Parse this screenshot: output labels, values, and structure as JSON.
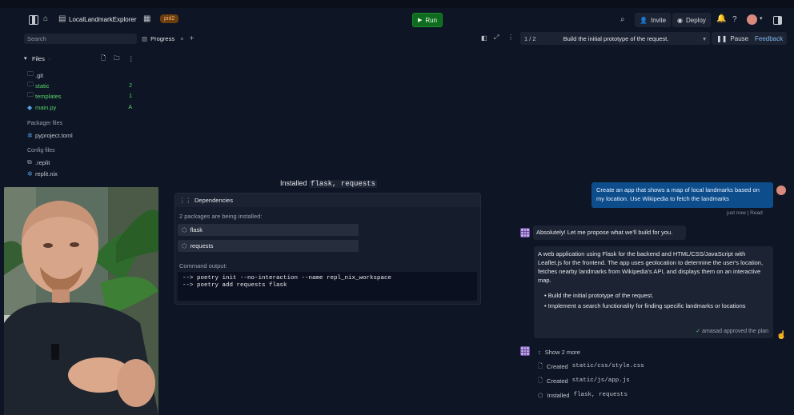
{
  "topbar": {
    "project_name": "LocalLandmarkExplorer",
    "branch_pill": "pid2",
    "run_label": "Run",
    "invite_label": "Invite",
    "deploy_label": "Deploy",
    "help_label": "?"
  },
  "sidebar": {
    "search_placeholder": "Search",
    "files_label": "Files",
    "items": [
      {
        "label": ".git",
        "badge": ""
      },
      {
        "label": "static",
        "badge": "2"
      },
      {
        "label": "templates",
        "badge": "1"
      },
      {
        "label": "main.py",
        "badge": "A"
      }
    ],
    "packager_label": "Packager files",
    "packager_items": [
      {
        "label": "pyproject.toml"
      }
    ],
    "config_label": "Config files",
    "config_items": [
      {
        "label": ".replit"
      },
      {
        "label": "replit.nix"
      }
    ]
  },
  "progress": {
    "tab_label": "Progress",
    "tab_close": "×",
    "add_tab": "+",
    "installed_prefix": "Installed",
    "installed_pkgs": "flask, requests",
    "deps_title": "Dependencies",
    "deps_subtitle": "2 packages are being installed:",
    "packages": [
      "flask",
      "requests"
    ],
    "cmd_label": "Command output:",
    "cmd_lines": [
      "--> poetry init --no-interaction --name repl_nix_workspace",
      "--> poetry add requests flask"
    ]
  },
  "chat": {
    "step_counter": "1 / 2",
    "step_title": "Build the initial prototype of the request.",
    "pause_label": "Pause",
    "feedback_label": "Feedback",
    "user_message": "Create an app that shows a map of local landmarks based on my location. Use Wikipedia to fetch the landmarks",
    "user_meta": "just now | Read",
    "agent_intro": "Absolutely! Let me propose what we'll build for you.",
    "agent_plan": "A web application using Flask for the backend and HTML/CSS/JavaScript with Leaflet.js for the frontend. The app uses geolocation to determine the user's location, fetches nearby landmarks from Wikipedia's API, and displays them on an interactive map.",
    "plan_items": [
      "Build the initial prototype of the request.",
      "Implement a search functionality for finding specific landmarks or locations"
    ],
    "approved_text": "amasad approved the plan",
    "show_more": "Show 2 more",
    "actions": [
      {
        "prefix": "Created",
        "code": "static/css/style.css"
      },
      {
        "prefix": "Created",
        "code": "static/js/app.js"
      },
      {
        "prefix": "Installed",
        "code": "flask, requests"
      }
    ]
  },
  "colors": {
    "accent_run": "#0f6b1f",
    "user_bubble": "#0d4d8c",
    "branch_pill": "#6b3e0f",
    "agent_avatar": "#6e4ea6"
  }
}
